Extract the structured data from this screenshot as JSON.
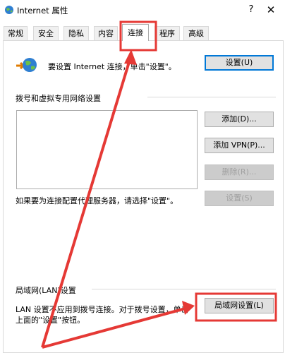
{
  "window": {
    "title": "Internet 属性",
    "help_glyph": "?",
    "close_glyph": "✕"
  },
  "tabs": [
    {
      "label": "常规"
    },
    {
      "label": "安全"
    },
    {
      "label": "隐私"
    },
    {
      "label": "内容"
    },
    {
      "label": "连接",
      "active": true
    },
    {
      "label": "程序"
    },
    {
      "label": "高级"
    }
  ],
  "setup": {
    "text": "要设置 Internet 连接，单击\"设置\"。",
    "button": "设置(U)"
  },
  "dialup": {
    "heading": "拨号和虚拟专用网络设置",
    "buttons": {
      "add": "添加(D)...",
      "add_vpn": "添加 VPN(P)...",
      "remove": "删除(R)...",
      "settings": "设置(S)"
    },
    "proxy_hint": "如果要为连接配置代理服务器，请选择\"设置\"。"
  },
  "lan": {
    "heading": "局域网(LAN)设置",
    "text_line1": "LAN 设置不应用到拨号连接。对于拨号设置，单击",
    "text_line2": "上面的\"设置\"按钮。",
    "button": "局域网设置(L)"
  },
  "annotation": {
    "color": "#e53935"
  }
}
